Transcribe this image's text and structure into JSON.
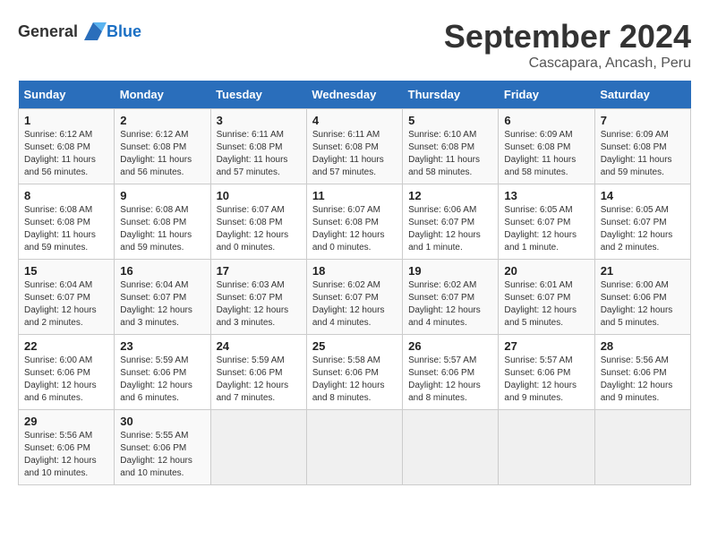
{
  "header": {
    "logo": {
      "general": "General",
      "blue": "Blue"
    },
    "month": "September 2024",
    "location": "Cascapara, Ancash, Peru"
  },
  "weekdays": [
    "Sunday",
    "Monday",
    "Tuesday",
    "Wednesday",
    "Thursday",
    "Friday",
    "Saturday"
  ],
  "weeks": [
    [
      {
        "day": "1",
        "info": "Sunrise: 6:12 AM\nSunset: 6:08 PM\nDaylight: 11 hours and 56 minutes."
      },
      {
        "day": "2",
        "info": "Sunrise: 6:12 AM\nSunset: 6:08 PM\nDaylight: 11 hours and 56 minutes."
      },
      {
        "day": "3",
        "info": "Sunrise: 6:11 AM\nSunset: 6:08 PM\nDaylight: 11 hours and 57 minutes."
      },
      {
        "day": "4",
        "info": "Sunrise: 6:11 AM\nSunset: 6:08 PM\nDaylight: 11 hours and 57 minutes."
      },
      {
        "day": "5",
        "info": "Sunrise: 6:10 AM\nSunset: 6:08 PM\nDaylight: 11 hours and 58 minutes."
      },
      {
        "day": "6",
        "info": "Sunrise: 6:09 AM\nSunset: 6:08 PM\nDaylight: 11 hours and 58 minutes."
      },
      {
        "day": "7",
        "info": "Sunrise: 6:09 AM\nSunset: 6:08 PM\nDaylight: 11 hours and 59 minutes."
      }
    ],
    [
      {
        "day": "8",
        "info": "Sunrise: 6:08 AM\nSunset: 6:08 PM\nDaylight: 11 hours and 59 minutes."
      },
      {
        "day": "9",
        "info": "Sunrise: 6:08 AM\nSunset: 6:08 PM\nDaylight: 11 hours and 59 minutes."
      },
      {
        "day": "10",
        "info": "Sunrise: 6:07 AM\nSunset: 6:08 PM\nDaylight: 12 hours and 0 minutes."
      },
      {
        "day": "11",
        "info": "Sunrise: 6:07 AM\nSunset: 6:08 PM\nDaylight: 12 hours and 0 minutes."
      },
      {
        "day": "12",
        "info": "Sunrise: 6:06 AM\nSunset: 6:07 PM\nDaylight: 12 hours and 1 minute."
      },
      {
        "day": "13",
        "info": "Sunrise: 6:05 AM\nSunset: 6:07 PM\nDaylight: 12 hours and 1 minute."
      },
      {
        "day": "14",
        "info": "Sunrise: 6:05 AM\nSunset: 6:07 PM\nDaylight: 12 hours and 2 minutes."
      }
    ],
    [
      {
        "day": "15",
        "info": "Sunrise: 6:04 AM\nSunset: 6:07 PM\nDaylight: 12 hours and 2 minutes."
      },
      {
        "day": "16",
        "info": "Sunrise: 6:04 AM\nSunset: 6:07 PM\nDaylight: 12 hours and 3 minutes."
      },
      {
        "day": "17",
        "info": "Sunrise: 6:03 AM\nSunset: 6:07 PM\nDaylight: 12 hours and 3 minutes."
      },
      {
        "day": "18",
        "info": "Sunrise: 6:02 AM\nSunset: 6:07 PM\nDaylight: 12 hours and 4 minutes."
      },
      {
        "day": "19",
        "info": "Sunrise: 6:02 AM\nSunset: 6:07 PM\nDaylight: 12 hours and 4 minutes."
      },
      {
        "day": "20",
        "info": "Sunrise: 6:01 AM\nSunset: 6:07 PM\nDaylight: 12 hours and 5 minutes."
      },
      {
        "day": "21",
        "info": "Sunrise: 6:00 AM\nSunset: 6:06 PM\nDaylight: 12 hours and 5 minutes."
      }
    ],
    [
      {
        "day": "22",
        "info": "Sunrise: 6:00 AM\nSunset: 6:06 PM\nDaylight: 12 hours and 6 minutes."
      },
      {
        "day": "23",
        "info": "Sunrise: 5:59 AM\nSunset: 6:06 PM\nDaylight: 12 hours and 6 minutes."
      },
      {
        "day": "24",
        "info": "Sunrise: 5:59 AM\nSunset: 6:06 PM\nDaylight: 12 hours and 7 minutes."
      },
      {
        "day": "25",
        "info": "Sunrise: 5:58 AM\nSunset: 6:06 PM\nDaylight: 12 hours and 8 minutes."
      },
      {
        "day": "26",
        "info": "Sunrise: 5:57 AM\nSunset: 6:06 PM\nDaylight: 12 hours and 8 minutes."
      },
      {
        "day": "27",
        "info": "Sunrise: 5:57 AM\nSunset: 6:06 PM\nDaylight: 12 hours and 9 minutes."
      },
      {
        "day": "28",
        "info": "Sunrise: 5:56 AM\nSunset: 6:06 PM\nDaylight: 12 hours and 9 minutes."
      }
    ],
    [
      {
        "day": "29",
        "info": "Sunrise: 5:56 AM\nSunset: 6:06 PM\nDaylight: 12 hours and 10 minutes."
      },
      {
        "day": "30",
        "info": "Sunrise: 5:55 AM\nSunset: 6:06 PM\nDaylight: 12 hours and 10 minutes."
      },
      {
        "day": "",
        "info": ""
      },
      {
        "day": "",
        "info": ""
      },
      {
        "day": "",
        "info": ""
      },
      {
        "day": "",
        "info": ""
      },
      {
        "day": "",
        "info": ""
      }
    ]
  ]
}
